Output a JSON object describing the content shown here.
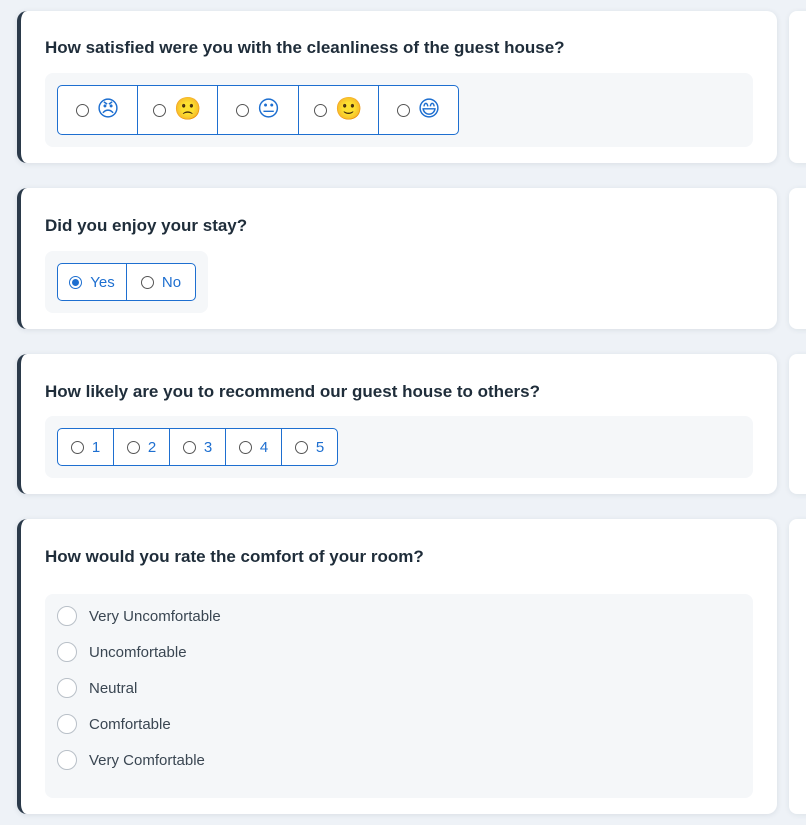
{
  "questions": {
    "q1": {
      "title": "How satisfied were you with the cleanliness of the guest house?",
      "options": [
        {
          "emoji": "😠",
          "icon": "angry-face-icon"
        },
        {
          "emoji": "🙁",
          "icon": "frowning-face-icon"
        },
        {
          "emoji": "😐",
          "icon": "neutral-face-icon"
        },
        {
          "emoji": "🙂",
          "icon": "slightly-smiling-face-icon"
        },
        {
          "emoji": "😄",
          "icon": "grinning-face-icon"
        }
      ]
    },
    "q2": {
      "title": "Did you enjoy your stay?",
      "options": [
        "Yes",
        "No"
      ],
      "selected": "Yes"
    },
    "q3": {
      "title": "How likely are you to recommend our guest house to others?",
      "options": [
        "1",
        "2",
        "3",
        "4",
        "5"
      ]
    },
    "q4": {
      "title": "How would you rate the comfort of your room?",
      "options": [
        "Very Uncomfortable",
        "Uncomfortable",
        "Neutral",
        "Comfortable",
        "Very Comfortable"
      ]
    }
  },
  "colors": {
    "accent": "#1e6fd0",
    "card_border": "#2b3a4a",
    "background": "#eef2f7",
    "panel": "#f5f7f9"
  }
}
